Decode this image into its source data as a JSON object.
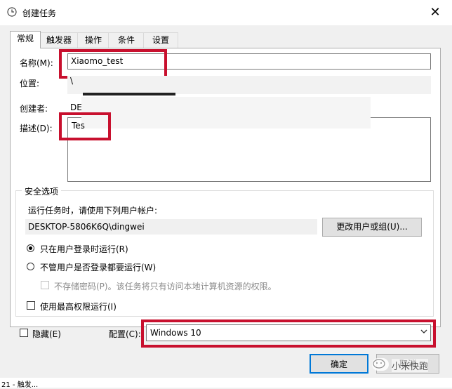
{
  "window": {
    "title": "创建任务",
    "close_symbol": "✕"
  },
  "tabs": [
    {
      "label": "常规",
      "active": true
    },
    {
      "label": "触发器",
      "active": false
    },
    {
      "label": "操作",
      "active": false
    },
    {
      "label": "条件",
      "active": false
    },
    {
      "label": "设置",
      "active": false
    }
  ],
  "general": {
    "name_label": "名称(M):",
    "name_value": "Xiaomo_test",
    "location_label": "位置:",
    "location_value": "\\",
    "author_label": "创建者:",
    "author_value": "DE",
    "description_label": "描述(D):",
    "description_value": "Tes"
  },
  "security": {
    "group_label": "安全选项",
    "run_as_prompt": "运行任务时，请使用下列用户帐户:",
    "user_account": "DESKTOP-5806K6Q\\dingwei",
    "change_user_button": "更改用户或组(U)...",
    "radio_logged_on": "只在用户登录时运行(R)",
    "radio_logged_on_selected": true,
    "radio_whether_logged": "不管用户是否登录都要运行(W)",
    "no_store_password": "不存储密码(P)。该任务将只有访问本地计算机资源的权限。",
    "highest_privileges": "使用最高权限运行(I)"
  },
  "bottom": {
    "hidden_label": "隐藏(E)",
    "configure_label": "配置(C):",
    "configure_value": "Windows 10",
    "ok_button": "确定",
    "cancel_button": "取消"
  },
  "taskbar": {
    "left_text": "21 - 触发..."
  },
  "watermark": {
    "text": "小米快跑"
  },
  "colors": {
    "highlight_red": "#c8102e",
    "window_bg": "#f0f0f0",
    "ok_border": "#0078d7"
  }
}
